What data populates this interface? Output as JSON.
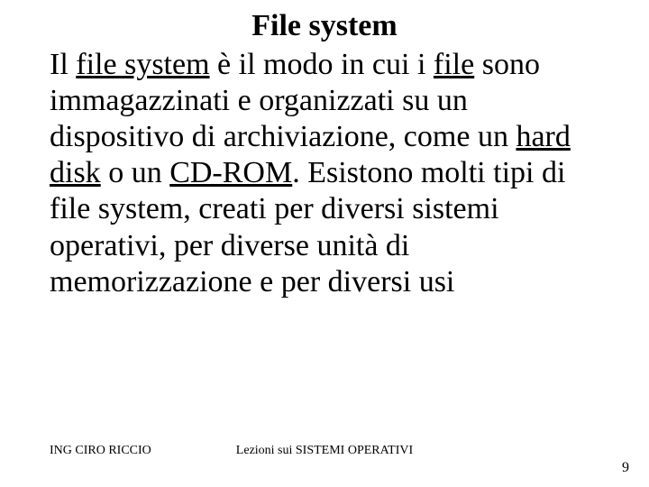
{
  "title": "File system",
  "body": {
    "t1": "Il ",
    "link1": "file system",
    "t2": " è il modo in cui i ",
    "link2": "file",
    "t3": " sono immagazzinati e organizzati su un dispositivo di archiviazione, come un ",
    "link3": "hard disk",
    "t4": " o un ",
    "link4": "CD-ROM",
    "t5": ". Esistono molti tipi di file system, creati per diversi sistemi operativi, per diverse unità di memorizzazione e per diversi usi"
  },
  "footer": {
    "author": "ING CIRO RICCIO",
    "series": "Lezioni sui SISTEMI OPERATIVI",
    "page": "9"
  }
}
